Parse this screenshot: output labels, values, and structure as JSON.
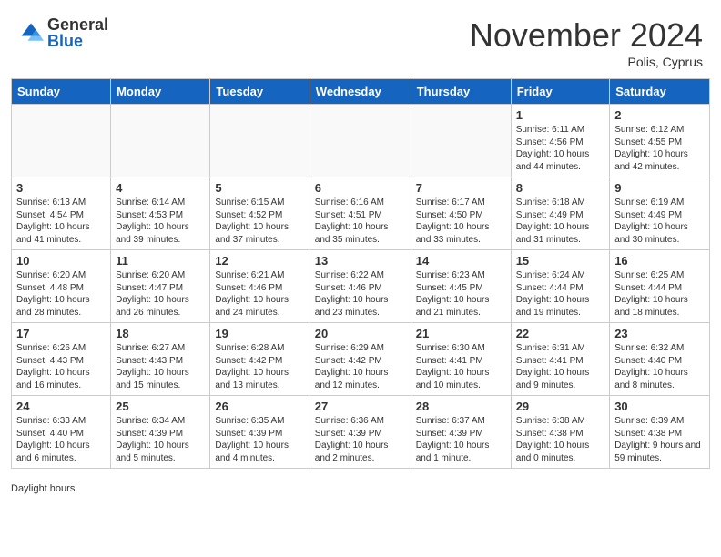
{
  "header": {
    "logo_general": "General",
    "logo_blue": "Blue",
    "month_title": "November 2024",
    "location": "Polis, Cyprus"
  },
  "days_of_week": [
    "Sunday",
    "Monday",
    "Tuesday",
    "Wednesday",
    "Thursday",
    "Friday",
    "Saturday"
  ],
  "weeks": [
    [
      {
        "day": "",
        "info": ""
      },
      {
        "day": "",
        "info": ""
      },
      {
        "day": "",
        "info": ""
      },
      {
        "day": "",
        "info": ""
      },
      {
        "day": "",
        "info": ""
      },
      {
        "day": "1",
        "info": "Sunrise: 6:11 AM\nSunset: 4:56 PM\nDaylight: 10 hours and 44 minutes."
      },
      {
        "day": "2",
        "info": "Sunrise: 6:12 AM\nSunset: 4:55 PM\nDaylight: 10 hours and 42 minutes."
      }
    ],
    [
      {
        "day": "3",
        "info": "Sunrise: 6:13 AM\nSunset: 4:54 PM\nDaylight: 10 hours and 41 minutes."
      },
      {
        "day": "4",
        "info": "Sunrise: 6:14 AM\nSunset: 4:53 PM\nDaylight: 10 hours and 39 minutes."
      },
      {
        "day": "5",
        "info": "Sunrise: 6:15 AM\nSunset: 4:52 PM\nDaylight: 10 hours and 37 minutes."
      },
      {
        "day": "6",
        "info": "Sunrise: 6:16 AM\nSunset: 4:51 PM\nDaylight: 10 hours and 35 minutes."
      },
      {
        "day": "7",
        "info": "Sunrise: 6:17 AM\nSunset: 4:50 PM\nDaylight: 10 hours and 33 minutes."
      },
      {
        "day": "8",
        "info": "Sunrise: 6:18 AM\nSunset: 4:49 PM\nDaylight: 10 hours and 31 minutes."
      },
      {
        "day": "9",
        "info": "Sunrise: 6:19 AM\nSunset: 4:49 PM\nDaylight: 10 hours and 30 minutes."
      }
    ],
    [
      {
        "day": "10",
        "info": "Sunrise: 6:20 AM\nSunset: 4:48 PM\nDaylight: 10 hours and 28 minutes."
      },
      {
        "day": "11",
        "info": "Sunrise: 6:20 AM\nSunset: 4:47 PM\nDaylight: 10 hours and 26 minutes."
      },
      {
        "day": "12",
        "info": "Sunrise: 6:21 AM\nSunset: 4:46 PM\nDaylight: 10 hours and 24 minutes."
      },
      {
        "day": "13",
        "info": "Sunrise: 6:22 AM\nSunset: 4:46 PM\nDaylight: 10 hours and 23 minutes."
      },
      {
        "day": "14",
        "info": "Sunrise: 6:23 AM\nSunset: 4:45 PM\nDaylight: 10 hours and 21 minutes."
      },
      {
        "day": "15",
        "info": "Sunrise: 6:24 AM\nSunset: 4:44 PM\nDaylight: 10 hours and 19 minutes."
      },
      {
        "day": "16",
        "info": "Sunrise: 6:25 AM\nSunset: 4:44 PM\nDaylight: 10 hours and 18 minutes."
      }
    ],
    [
      {
        "day": "17",
        "info": "Sunrise: 6:26 AM\nSunset: 4:43 PM\nDaylight: 10 hours and 16 minutes."
      },
      {
        "day": "18",
        "info": "Sunrise: 6:27 AM\nSunset: 4:43 PM\nDaylight: 10 hours and 15 minutes."
      },
      {
        "day": "19",
        "info": "Sunrise: 6:28 AM\nSunset: 4:42 PM\nDaylight: 10 hours and 13 minutes."
      },
      {
        "day": "20",
        "info": "Sunrise: 6:29 AM\nSunset: 4:42 PM\nDaylight: 10 hours and 12 minutes."
      },
      {
        "day": "21",
        "info": "Sunrise: 6:30 AM\nSunset: 4:41 PM\nDaylight: 10 hours and 10 minutes."
      },
      {
        "day": "22",
        "info": "Sunrise: 6:31 AM\nSunset: 4:41 PM\nDaylight: 10 hours and 9 minutes."
      },
      {
        "day": "23",
        "info": "Sunrise: 6:32 AM\nSunset: 4:40 PM\nDaylight: 10 hours and 8 minutes."
      }
    ],
    [
      {
        "day": "24",
        "info": "Sunrise: 6:33 AM\nSunset: 4:40 PM\nDaylight: 10 hours and 6 minutes."
      },
      {
        "day": "25",
        "info": "Sunrise: 6:34 AM\nSunset: 4:39 PM\nDaylight: 10 hours and 5 minutes."
      },
      {
        "day": "26",
        "info": "Sunrise: 6:35 AM\nSunset: 4:39 PM\nDaylight: 10 hours and 4 minutes."
      },
      {
        "day": "27",
        "info": "Sunrise: 6:36 AM\nSunset: 4:39 PM\nDaylight: 10 hours and 2 minutes."
      },
      {
        "day": "28",
        "info": "Sunrise: 6:37 AM\nSunset: 4:39 PM\nDaylight: 10 hours and 1 minute."
      },
      {
        "day": "29",
        "info": "Sunrise: 6:38 AM\nSunset: 4:38 PM\nDaylight: 10 hours and 0 minutes."
      },
      {
        "day": "30",
        "info": "Sunrise: 6:39 AM\nSunset: 4:38 PM\nDaylight: 9 hours and 59 minutes."
      }
    ]
  ],
  "footer": {
    "daylight_hours_label": "Daylight hours"
  }
}
